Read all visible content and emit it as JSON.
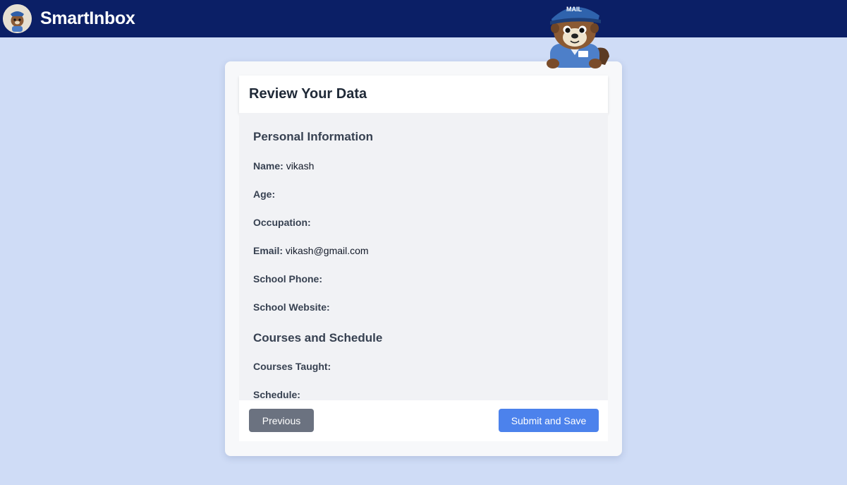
{
  "header": {
    "brand": "SmartInbox",
    "mascot_badge": "MAIL",
    "colors": {
      "bar": "#0b1f66",
      "background": "#cfdcf6"
    }
  },
  "card": {
    "title": "Review Your Data",
    "sections": [
      {
        "title": "Personal Information",
        "fields": [
          {
            "label": "Name:",
            "value": "vikash"
          },
          {
            "label": "Age:",
            "value": ""
          },
          {
            "label": "Occupation:",
            "value": ""
          },
          {
            "label": "Email:",
            "value": "vikash@gmail.com"
          },
          {
            "label": "School Phone:",
            "value": ""
          },
          {
            "label": "School Website:",
            "value": ""
          }
        ]
      },
      {
        "title": "Courses and Schedule",
        "fields": [
          {
            "label": "Courses Taught:",
            "value": ""
          },
          {
            "label": "Schedule:",
            "value": ""
          }
        ]
      }
    ]
  },
  "footer": {
    "previous_label": "Previous",
    "submit_label": "Submit and Save",
    "colors": {
      "previous": "#6b7280",
      "submit": "#4c82ec"
    }
  },
  "icons": [
    "app-logo-icon",
    "otter-mail-mascot-icon"
  ]
}
